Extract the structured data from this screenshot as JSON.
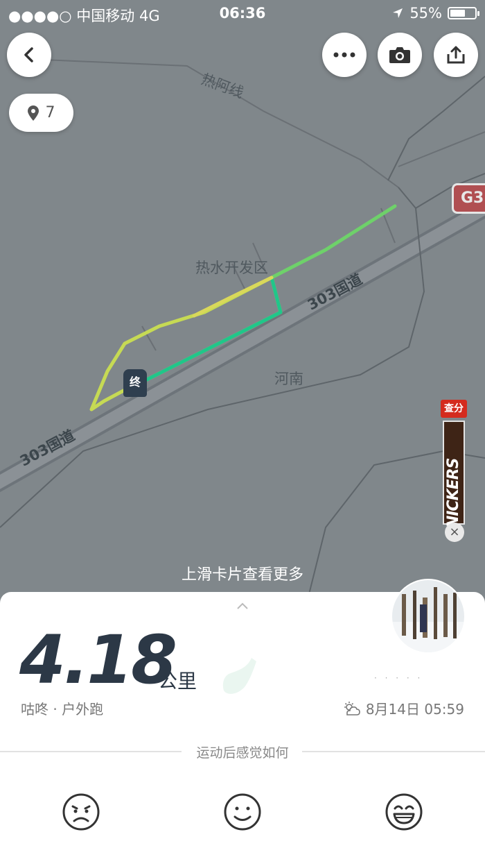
{
  "status": {
    "carrier": "●●●●○ 中国移动   4G",
    "time": "06:36",
    "battery": "55%"
  },
  "map": {
    "labels": {
      "route_name": "热阿线",
      "district": "热水开发区",
      "road1": "303国道",
      "road2": "303国道",
      "area": "河南",
      "highway": "G3"
    },
    "photo_count": "7",
    "end_marker": "终"
  },
  "ad": {
    "badge": "查分",
    "brand": "SNICKERS",
    "close": "×"
  },
  "hint": "上滑卡片查看更多",
  "summary": {
    "distance": "4.18",
    "unit": "公里",
    "subtitle": "咕咚 · 户外跑",
    "user": "· ·  ·  · ·",
    "date": "8月14日 05:59"
  },
  "feedback": {
    "prompt": "运动后感觉如何"
  },
  "colors": {
    "map_bg": "#80878b",
    "route_start": "#20c68a",
    "route_end": "#8fd84e",
    "dark": "#2c3846"
  }
}
